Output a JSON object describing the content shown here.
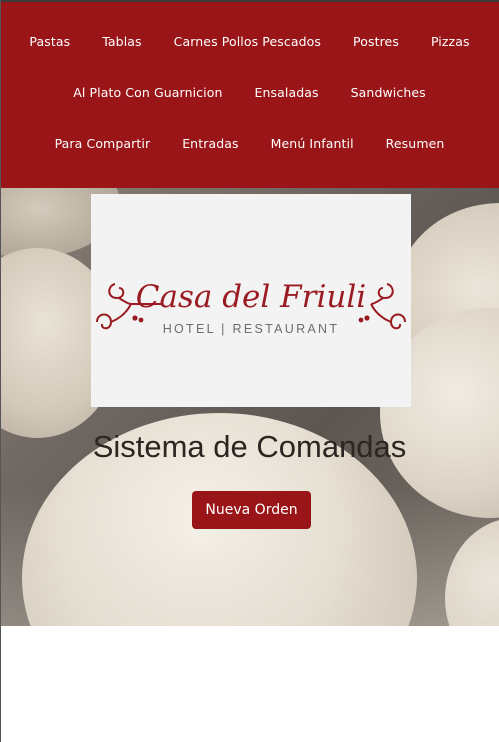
{
  "nav": {
    "row1": [
      "Pastas",
      "Tablas",
      "Carnes Pollos Pescados",
      "Postres",
      "Pizzas"
    ],
    "row2": [
      "Al Plato Con Guarnicion",
      "Ensaladas",
      "Sandwiches"
    ],
    "row3": [
      "Para Compartir",
      "Entradas",
      "Menú Infantil",
      "Resumen"
    ]
  },
  "logo": {
    "name": "Casa del Friuli",
    "subtitle": "HOTEL | RESTAURANT"
  },
  "hero": {
    "title": "Sistema de Comandas",
    "button_label": "Nueva Orden"
  },
  "colors": {
    "brand": "#9a1518",
    "nav_text": "#ffffff",
    "title_text": "#2b2622"
  }
}
